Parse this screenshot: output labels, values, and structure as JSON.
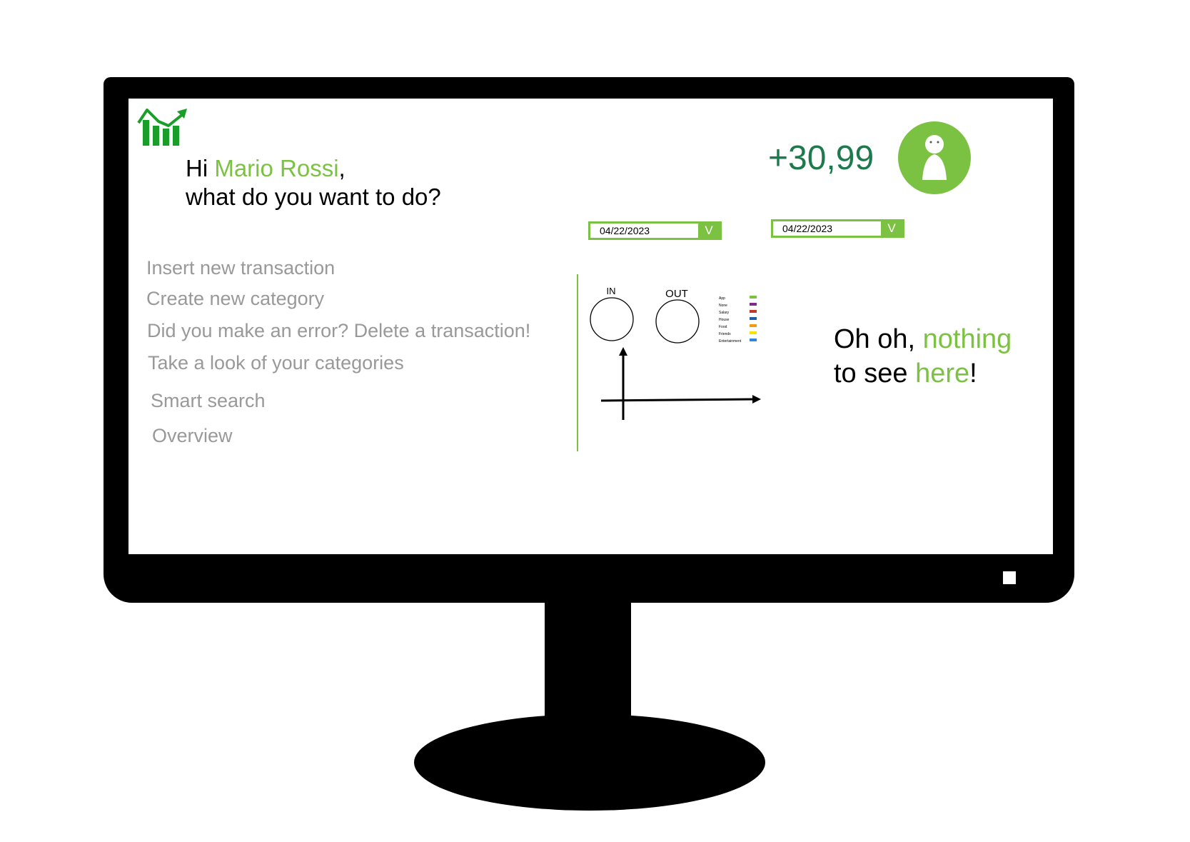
{
  "app": {
    "greeting_prefix": "Hi ",
    "user_name": "Mario Rossi",
    "greeting_suffix": ",",
    "prompt": "what do you want to do?",
    "balance": "+30,99"
  },
  "menu": {
    "items": [
      {
        "label": "Insert new transaction"
      },
      {
        "label": "Create new category"
      },
      {
        "label": "Did you make an error? Delete a transaction!"
      },
      {
        "label": "Take a look of your categories"
      },
      {
        "label": "Smart search"
      },
      {
        "label": "Overview"
      }
    ]
  },
  "filters": {
    "date_from": "04/22/2023",
    "date_to": "04/22/2023",
    "chevron": "V"
  },
  "charts": {
    "in_label": "IN",
    "out_label": "OUT",
    "legend": [
      {
        "label": "App",
        "color": "#7cc242"
      },
      {
        "label": "None",
        "color": "#7b2d8e"
      },
      {
        "label": "Salary",
        "color": "#c0392b"
      },
      {
        "label": "House",
        "color": "#1f5fa8"
      },
      {
        "label": "Food",
        "color": "#f39c12"
      },
      {
        "label": "Friends",
        "color": "#f5e400"
      },
      {
        "label": "Entertainment",
        "color": "#2e86de"
      }
    ]
  },
  "empty_state": {
    "part1": "Oh oh, ",
    "part2": "nothing",
    "part3": "to see ",
    "part4": "here",
    "part5": "!"
  },
  "colors": {
    "accent": "#7cc242",
    "balance": "#1e7a4d",
    "menu_text": "#999999"
  },
  "icons": [
    "growth-chart-logo-icon",
    "user-avatar-icon",
    "chevron-down-icon"
  ]
}
